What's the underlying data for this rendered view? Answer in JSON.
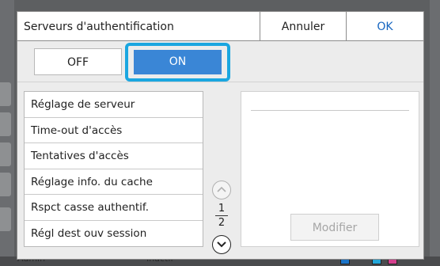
{
  "dialog": {
    "title": "Serveurs d'authentification",
    "cancel_label": "Annuler",
    "ok_label": "OK"
  },
  "toggle": {
    "off_label": "OFF",
    "on_label": "ON",
    "selected": "ON"
  },
  "settings_list": {
    "items": [
      "Réglage de serveur",
      "Time-out d'accès",
      "Tentatives d'accès",
      "Réglage info. du cache",
      "Rspct casse authentif.",
      "Régl dest ouv session"
    ]
  },
  "pager": {
    "current": "1",
    "total": "2"
  },
  "detail": {
    "modify_label": "Modifier"
  },
  "background_status": {
    "user": "Admin",
    "state": "Inactif"
  },
  "colors": {
    "accent": "#3a86d6",
    "highlight_ring": "#1aa6e0",
    "ok_text": "#1565c0"
  }
}
